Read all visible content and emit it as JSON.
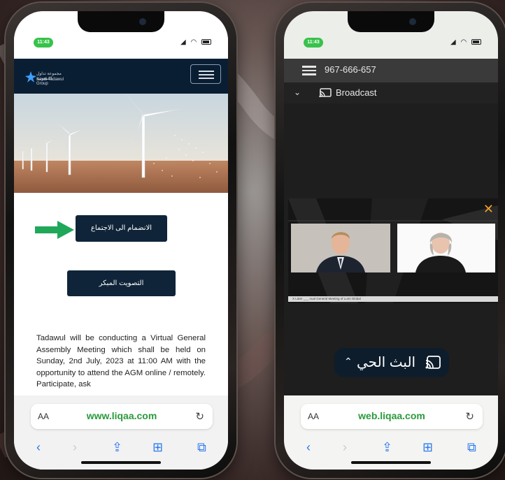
{
  "left_phone": {
    "status": {
      "time": "11:43"
    },
    "brand": {
      "logo_ar": "مجموعة تداول السعودية",
      "logo_en": "Saudi Tadawul Group"
    },
    "buttons": {
      "join_meeting": "الانضمام الى الاجتماع",
      "early_voting": "التصويت المبكر"
    },
    "paragraph": "Tadawul will be conducting a Virtual General Assembly Meeting which shall be held on Sunday, 2nd July, 2023 at 11:00 AM with the opportunity to attend the AGM online / remotely. Participate, ask",
    "browser": {
      "text_size": "AA",
      "url": "www.liqaa.com"
    }
  },
  "right_phone": {
    "status": {
      "time": "11:43"
    },
    "call_header": {
      "phone_number": "967-666-657"
    },
    "broadcast": {
      "label": "Broadcast"
    },
    "stage": {
      "ticker_text": "X Lüter   ___ nual General Meeting of Lumi Global"
    },
    "live_button": {
      "label": "البث الحي"
    },
    "browser": {
      "text_size": "AA",
      "url": "web.liqaa.com"
    }
  },
  "colors": {
    "navy": "#0f2438",
    "url_green": "#2a9a3c",
    "status_green": "#37c24a",
    "ios_blue": "#2b7af0",
    "close_orange": "#f2a12a"
  }
}
